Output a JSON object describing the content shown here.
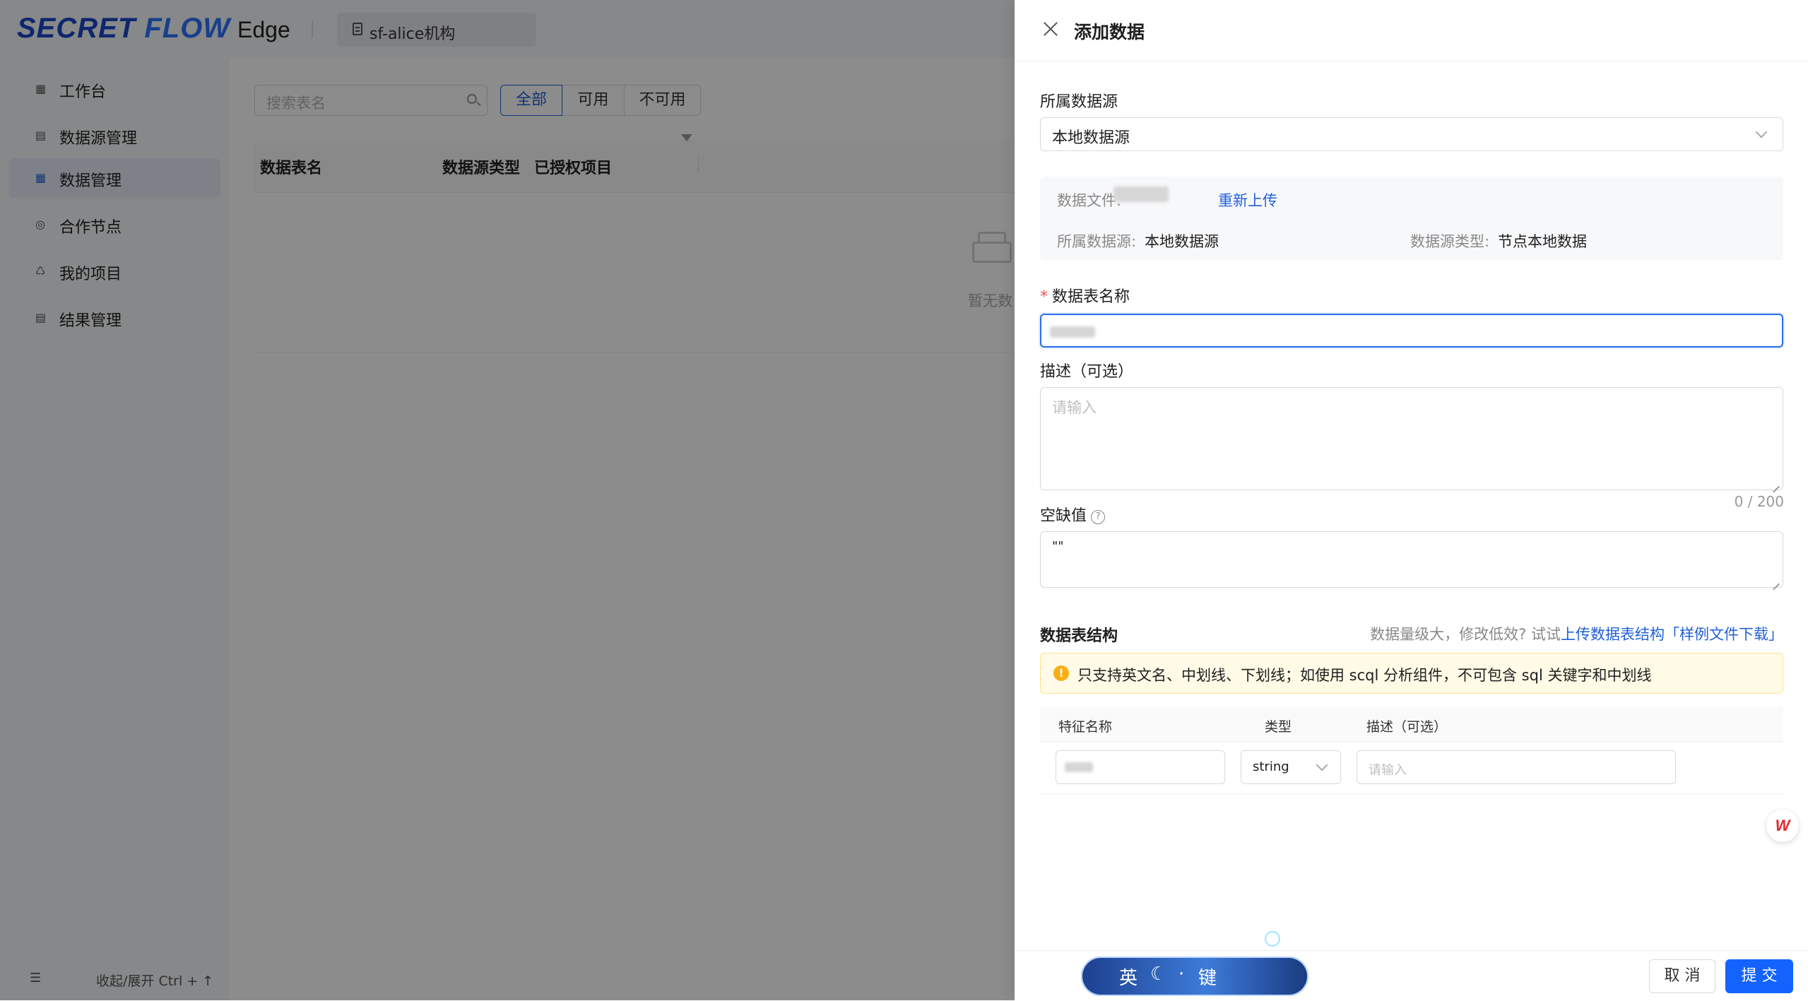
{
  "brand": {
    "logo_text_a": "SECRET",
    "logo_text_b": "FLOW",
    "app_name": "Edge",
    "org": "sf-alice机构"
  },
  "sidebar": {
    "items": [
      {
        "label": "工作台",
        "icon": "grid-icon"
      },
      {
        "label": "数据源管理",
        "icon": "database-icon"
      },
      {
        "label": "数据管理",
        "icon": "table-icon"
      },
      {
        "label": "合作节点",
        "icon": "globe-icon"
      },
      {
        "label": "我的项目",
        "icon": "project-icon"
      },
      {
        "label": "结果管理",
        "icon": "result-icon"
      }
    ],
    "active_index": 2,
    "collapse_label": "收起/展开 Ctrl + ↑"
  },
  "main": {
    "search_placeholder": "搜索表名",
    "filters": [
      "全部",
      "可用",
      "不可用"
    ],
    "columns": [
      "数据表名",
      "数据源类型",
      "已授权项目"
    ],
    "empty_text": "暂无数"
  },
  "drawer": {
    "title": "添加数据",
    "datasource_label": "所属数据源",
    "datasource_value": "本地数据源",
    "info": {
      "file_key": "数据文件:",
      "reupload": "重新上传",
      "ds_key": "所属数据源:",
      "ds_value": "本地数据源",
      "type_key": "数据源类型:",
      "type_value": "节点本地数据"
    },
    "table_name_label": "数据表名称",
    "desc_label": "描述（可选）",
    "desc_placeholder": "请输入",
    "desc_count": "0 / 200",
    "null_label": "空缺值",
    "null_value": "\"\"",
    "schema": {
      "title": "数据表结构",
      "hint_prefix": "数据量级大，修改低效? 试试",
      "hint_link": "上传数据表结构「样例文件下载」",
      "warning": "只支持英文名、中划线、下划线；如使用 scql 分析组件，不可包含 sql 关键字和中划线",
      "columns": [
        "特征名称",
        "类型",
        "描述（可选）"
      ],
      "row": {
        "type": "string",
        "desc_placeholder": "请输入"
      }
    },
    "footer": {
      "cancel": "取 消",
      "submit": "提 交"
    },
    "wps_badge": "W"
  },
  "ime": {
    "mode": "英",
    "moon": "☾",
    "dot": "·",
    "key": "键"
  }
}
